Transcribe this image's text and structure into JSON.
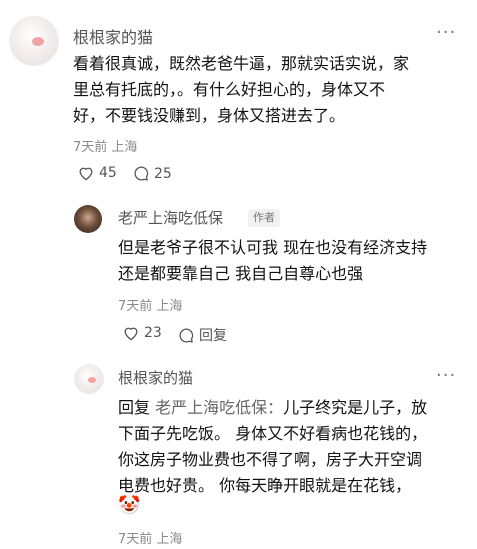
{
  "comment1": {
    "username": "根根家的猫",
    "text_lines": [
      "看着很真诚，既然老爸牛逼，那就实话实说，家",
      "里总有托底的，。有什么好担心的，身体又不",
      "好，不要钱没赚到，身体又搭进去了。"
    ],
    "meta": "7天前 上海",
    "likes": "45",
    "comments": "25",
    "more_label": "···"
  },
  "reply1": {
    "username": "老严上海吃低保",
    "badge": "作者",
    "text_lines": [
      "但是老爷子很不认可我 现在也没有经济支持",
      "还是都要靠自己 我自己自尊心也强"
    ],
    "meta": "7天前 上海",
    "likes": "23",
    "reply_label": "回复"
  },
  "reply2": {
    "username": "根根家的猫",
    "reply_prefix": "回复 ",
    "reply_target": "老严上海吃低保：",
    "text_first": "儿子终究是儿子，放",
    "text_lines": [
      "下面子先吃饭。 身体又不好看病也花钱的，",
      "你这房子物业费也不得了啊，房子大开空调",
      "电费也好贵。 你每天睁开眼就是在花钱，"
    ],
    "emoji": "🤡",
    "meta": "7天前 上海",
    "more_label": "···"
  }
}
